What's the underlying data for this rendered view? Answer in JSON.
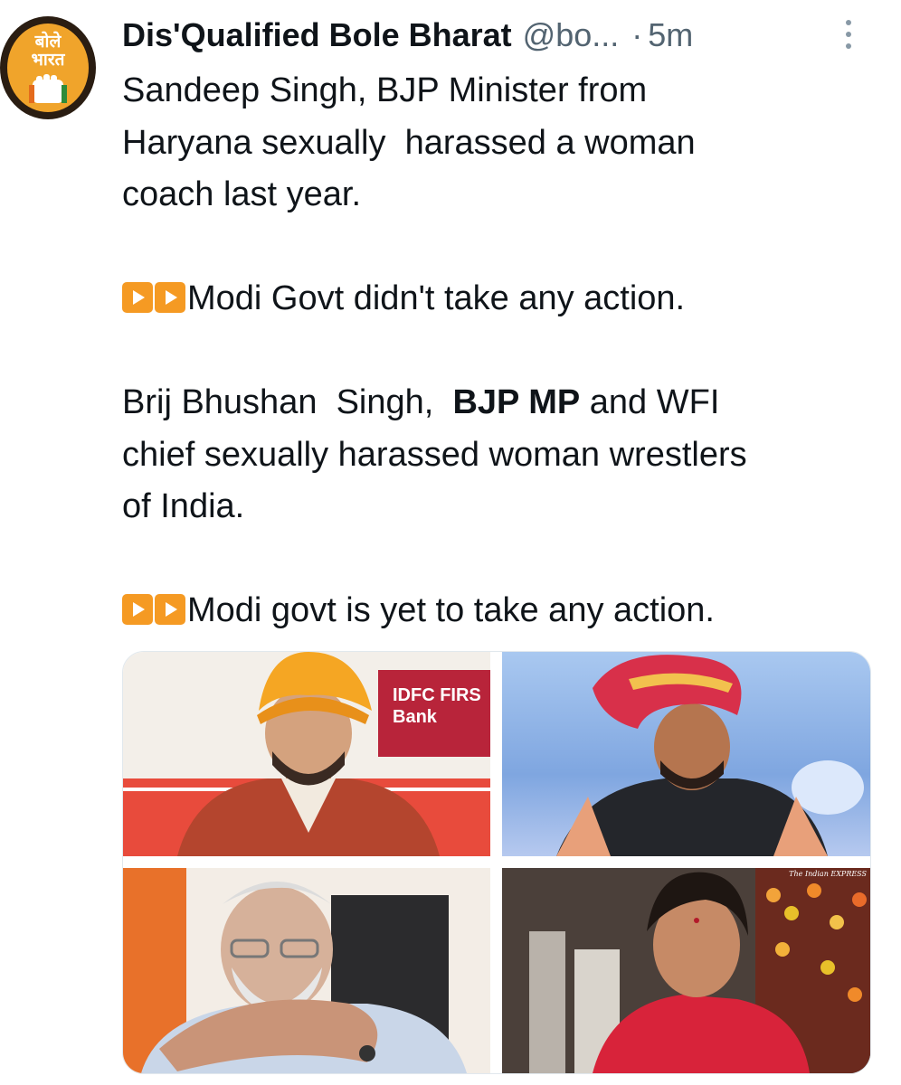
{
  "tweet": {
    "avatar": {
      "logo_text_line1": "बोले",
      "logo_text_line2": "भारत"
    },
    "display_name": "Dis'Qualified Bole Bharat",
    "handle": "@bo...",
    "separator": "·",
    "timestamp": "5m",
    "more_icon": "more-vertical-icon",
    "text": {
      "p1_line1": "Sandeep Singh, BJP Minister from",
      "p1_line2": "Haryana sexually  harassed a woman",
      "p1_line3": "coach last year.",
      "p2_line1": "Modi Govt didn't take any action.",
      "p3_line1_a": "Brij Bhushan  Singh,  ",
      "p3_line1_b": "BJP MP",
      "p3_line1_c": " and WFI",
      "p3_line2": "chief sexually harassed woman wrestlers",
      "p3_line3": "of India.",
      "p4_line1": "Modi govt is yet to take any action."
    },
    "emoji": "play-button-emoji",
    "media": {
      "bank_sign": "IDFC FIRS\nBank",
      "watermark": "The Indian EXPRESS"
    }
  },
  "colors": {
    "text": "#0f1419",
    "secondary": "#536471",
    "emoji_orange": "#f59a23",
    "bank_red": "#b8243a"
  }
}
